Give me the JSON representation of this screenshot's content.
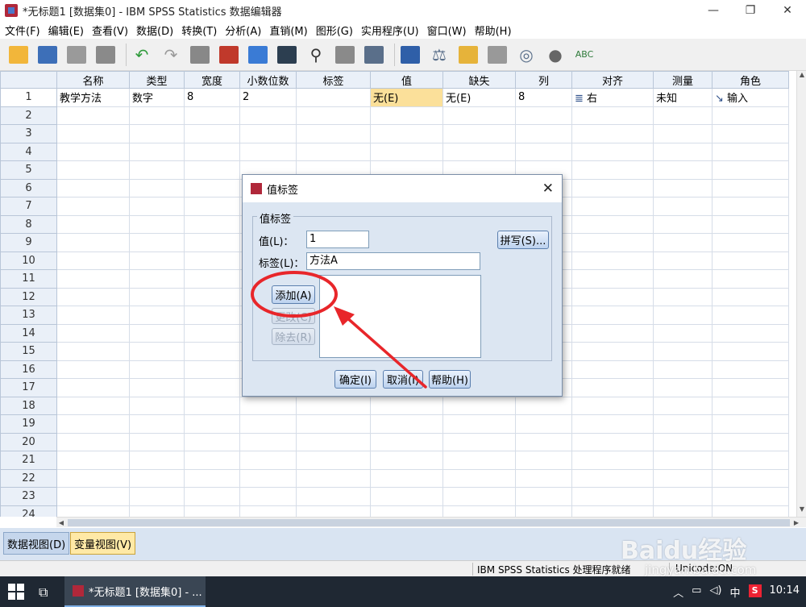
{
  "window": {
    "title": "*无标题1 [数据集0] - IBM SPSS Statistics 数据编辑器"
  },
  "menu": [
    "文件(F)",
    "编辑(E)",
    "查看(V)",
    "数据(D)",
    "转换(T)",
    "分析(A)",
    "直销(M)",
    "图形(G)",
    "实用程序(U)",
    "窗口(W)",
    "帮助(H)"
  ],
  "grid": {
    "columns": [
      "名称",
      "类型",
      "宽度",
      "小数位数",
      "标签",
      "值",
      "缺失",
      "列",
      "对齐",
      "测量",
      "角色"
    ],
    "row1": {
      "num": "1",
      "cells": [
        "教学方法",
        "数字",
        "8",
        "2",
        "",
        "无(E)",
        "无(E)",
        "8",
        "右",
        "未知",
        "输入"
      ]
    },
    "row_numbers": [
      "2",
      "3",
      "4",
      "5",
      "6",
      "7",
      "8",
      "9",
      "10",
      "11",
      "12",
      "13",
      "14",
      "15",
      "16",
      "17",
      "18",
      "19",
      "20",
      "21",
      "22",
      "23",
      "24"
    ]
  },
  "tabs": {
    "data_view": "数据视图(D)",
    "variable_view": "变量视图(V)"
  },
  "status": {
    "processor": "IBM SPSS Statistics 处理程序就绪",
    "unicode": "Unicode:ON"
  },
  "dialog": {
    "title": "值标签",
    "group_label": "值标签",
    "value_label": "值(L)：",
    "value_input": "1",
    "label_label": "标签(L)：",
    "label_input": "方法A",
    "spell_button": "拼写(S)...",
    "add_button": "添加(A)",
    "change_button": "更改(C)",
    "remove_button": "除去(R)",
    "ok_button": "确定(I)",
    "cancel_button": "取消(I)",
    "help_button": "帮助(H)"
  },
  "taskbar": {
    "task_title": "*无标题1 [数据集0] - ...",
    "ime": "中",
    "time": "10:14"
  },
  "watermark": {
    "brand": "Baidu经验",
    "url": "jingyan.baidu.com"
  },
  "colors": {
    "highlight": "#fbe09a",
    "annotation": "#e8262a",
    "header_bg": "#eaf0f8"
  }
}
